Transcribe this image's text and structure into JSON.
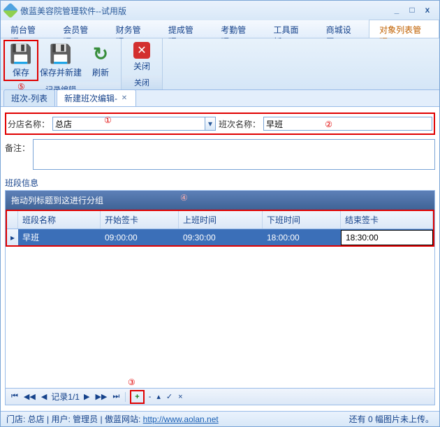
{
  "window": {
    "title": "傲蓝美容院管理软件--试用版",
    "buttons": {
      "min": "_",
      "max": "□",
      "close": "x"
    }
  },
  "menus": [
    "前台管理",
    "会员管理",
    "财务管理",
    "提成管理",
    "考勤管理",
    "工具面板",
    "商城设置",
    "对象列表管理"
  ],
  "active_menu_index": 7,
  "ribbon": {
    "group1": {
      "label": "记录编辑",
      "save": "保存",
      "save_new": "保存并新建",
      "refresh": "刷新"
    },
    "group2": {
      "label": "关闭",
      "close": "关闭"
    }
  },
  "tabs": [
    {
      "label": "班次-列表",
      "active": false,
      "closable": false
    },
    {
      "label": "新建班次编辑-",
      "active": true,
      "closable": true
    }
  ],
  "form": {
    "branch_label": "分店名称：",
    "branch_value": "总店",
    "shift_label": "班次名称：",
    "shift_value": "早班",
    "remark_label": "备注：",
    "remark_value": ""
  },
  "grid": {
    "section_label": "班段信息",
    "group_hint": "拖动列标题到这进行分组",
    "columns": [
      "班段名称",
      "开始签卡",
      "上班时间",
      "下班时间",
      "结束签卡"
    ],
    "rows": [
      {
        "name": "早班",
        "start": "09:00:00",
        "on": "09:30:00",
        "off": "18:00:00",
        "end": "18:30:00",
        "selected": true,
        "editing": "end"
      }
    ]
  },
  "navigator": {
    "record_text": "记录1/1",
    "add": "+",
    "del": "-",
    "edit": "▴",
    "ok": "✓",
    "cancel": "×"
  },
  "status": {
    "left_prefix": "门店: ",
    "branch": "总店",
    "user_prefix": " | 用户: ",
    "user": "管理员",
    "site_prefix": " | 傲蓝网站: ",
    "url": "http://www.aolan.net",
    "right": "还有 0 幅图片未上传。"
  },
  "annotation": {
    "1": "①",
    "2": "②",
    "3": "③",
    "4": "④",
    "5": "⑤"
  }
}
